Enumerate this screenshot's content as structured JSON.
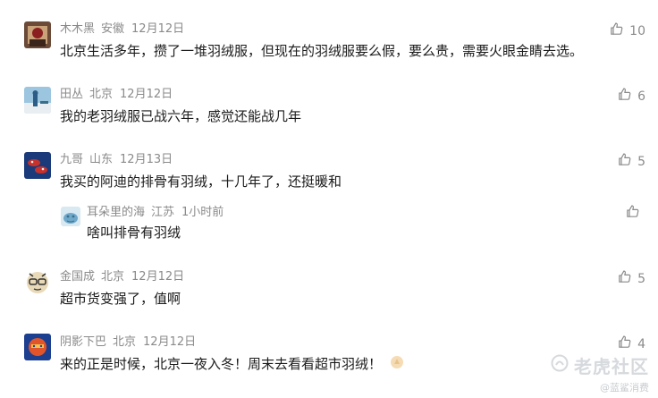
{
  "comments": [
    {
      "user": "木木黑",
      "location": "安徽",
      "date": "12月12日",
      "text": "北京生活多年，攒了一堆羽绒服，但现在的羽绒服要么假，要么贵，需要火眼金睛去选。",
      "likes": "10",
      "avatar_colors": [
        "#5a3b2e",
        "#c9a27a",
        "#8b1e1e"
      ]
    },
    {
      "user": "田丛",
      "location": "北京",
      "date": "12月12日",
      "text": "我的老羽绒服已战六年，感觉还能战几年",
      "likes": "6",
      "avatar_colors": [
        "#2b5d86",
        "#9cc6e0",
        "#e8eef2"
      ]
    },
    {
      "user": "九哥",
      "location": "山东",
      "date": "12月13日",
      "text": "我买的阿迪的排骨有羽绒，十几年了，还挺暖和",
      "likes": "5",
      "avatar_colors": [
        "#1b3a7a",
        "#c8322c",
        "#f0f0f0"
      ]
    },
    {
      "user": "金国成",
      "location": "北京",
      "date": "12月12日",
      "text": "超市货变强了，值啊",
      "likes": "5",
      "avatar_colors": [
        "#e8d9b8",
        "#333333",
        "#ffffff"
      ]
    },
    {
      "user": "阴影下巴",
      "location": "北京",
      "date": "12月12日",
      "text": "来的正是时候，北京一夜入冬！周末去看看超市羽绒！",
      "likes": "4",
      "avatar_colors": [
        "#1d3f8f",
        "#e2552a",
        "#f2c14e"
      ]
    }
  ],
  "reply": {
    "user": "耳朵里的海",
    "location": "江苏",
    "time": "1小时前",
    "text": "啥叫排骨有羽绒",
    "likes": "",
    "avatar_colors": [
      "#6fa8c9",
      "#d8e9f2",
      "#3b6e8a"
    ]
  },
  "watermark": {
    "main": "老虎社区",
    "sub": "@蓝鲨消费"
  },
  "icons": {
    "like": "thumbs-up-icon",
    "emoji": "hands-emoji-icon",
    "logo": "tiger-logo-icon"
  }
}
